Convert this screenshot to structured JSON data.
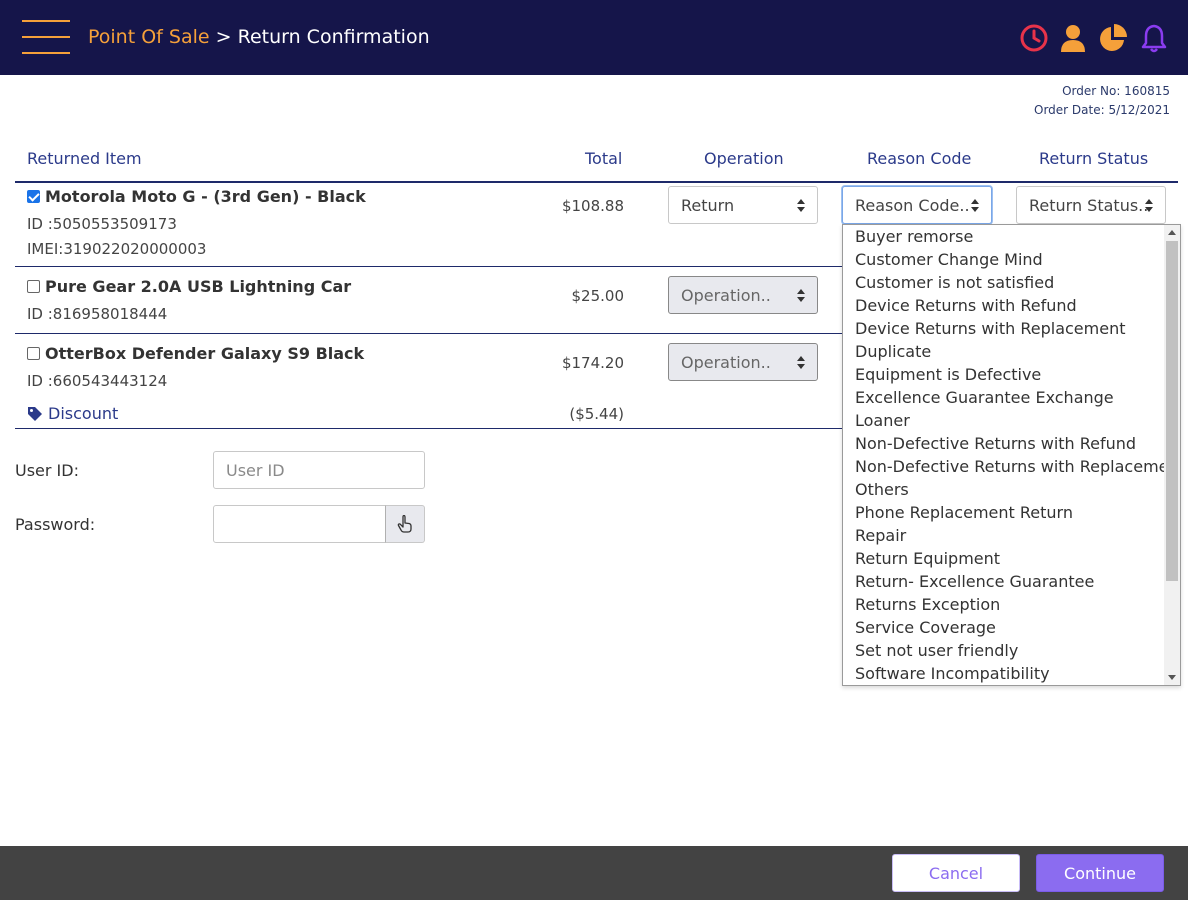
{
  "header": {
    "menu_icon": "hamburger-menu-icon",
    "breadcrumb_root": "Point Of Sale",
    "breadcrumb_sep": ">",
    "breadcrumb_current": "Return Confirmation",
    "icons": [
      "clock-icon",
      "user-icon",
      "pie-chart-icon",
      "bell-icon"
    ],
    "colors": {
      "bg": "#15154a",
      "accent": "#f5a03a",
      "clock": "#e8334a",
      "bell": "#8a3cf0"
    }
  },
  "order": {
    "number_text": "Order No: 160815",
    "date_text": "Order Date: 5/12/2021"
  },
  "table": {
    "columns": [
      "Returned Item",
      "Total",
      "Operation",
      "Reason Code",
      "Return Status"
    ],
    "rows": [
      {
        "checked": true,
        "name": "Motorola Moto G - (3rd Gen) - Black",
        "id": "ID :5050553509173",
        "imei": "IMEI:319022020000003",
        "total": "$108.88",
        "operation": "Return",
        "reason": "Reason Code..",
        "status": "Return Status.."
      },
      {
        "checked": false,
        "name": "Pure Gear 2.0A USB Lightning Car",
        "id": "ID :816958018444",
        "total": "$25.00",
        "operation": "Operation.."
      },
      {
        "checked": false,
        "name": "OtterBox Defender Galaxy S9 Black",
        "id": "ID :660543443124",
        "total": "$174.20",
        "operation": "Operation.."
      }
    ],
    "discount_label": "Discount",
    "discount_value": "($5.44)"
  },
  "credentials": {
    "user_label": "User ID:",
    "user_placeholder": "User ID",
    "password_label": "Password:"
  },
  "reason_options": [
    "Buyer remorse",
    "Customer Change Mind",
    "Customer is not satisfied",
    "Device Returns with Refund",
    "Device Returns with Replacement",
    "Duplicate",
    "Equipment is Defective",
    "Excellence Guarantee Exchange",
    "Loaner",
    "Non-Defective Returns with Refund",
    "Non-Defective Returns with Replacement",
    "Others",
    "Phone Replacement Return",
    "Repair",
    "Return Equipment",
    "Return- Excellence Guarantee",
    "Returns Exception",
    "Service Coverage",
    "Set not user friendly",
    "Software Incompatibility"
  ],
  "footer": {
    "cancel_label": "Cancel",
    "continue_label": "Continue",
    "accent": "#8b6cf0"
  }
}
